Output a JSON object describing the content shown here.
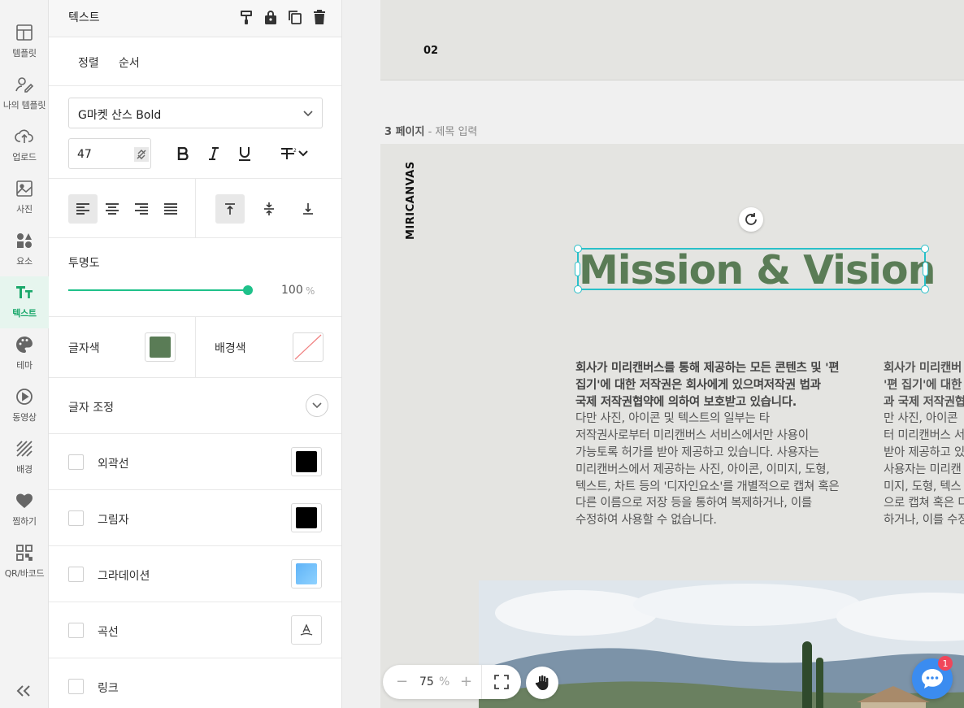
{
  "rail": {
    "items": [
      {
        "label": "템플릿",
        "icon": "template-icon"
      },
      {
        "label": "나의 템플릿",
        "icon": "my-template-icon"
      },
      {
        "label": "업로드",
        "icon": "upload-icon"
      },
      {
        "label": "사진",
        "icon": "photo-icon"
      },
      {
        "label": "요소",
        "icon": "elements-icon"
      },
      {
        "label": "텍스트",
        "icon": "text-icon",
        "active": true
      },
      {
        "label": "테마",
        "icon": "palette-icon"
      },
      {
        "label": "동영상",
        "icon": "video-icon"
      },
      {
        "label": "배경",
        "icon": "background-icon"
      },
      {
        "label": "찜하기",
        "icon": "heart-icon"
      },
      {
        "label": "QR/바코드",
        "icon": "qr-icon"
      }
    ],
    "collapse": "<<"
  },
  "panel": {
    "title": "텍스트",
    "header_icons": [
      "paint-roller-icon",
      "lock-icon",
      "duplicate-icon",
      "trash-icon"
    ],
    "tabs": {
      "align": "정렬",
      "order": "순서"
    },
    "font_family": "G마켓 산스 Bold",
    "font_size": "47",
    "opacity_label": "투명도",
    "opacity_value": "100",
    "opacity_unit": "%",
    "opacity_fraction": 1.0,
    "text_color_label": "글자색",
    "text_color": "#5a7c56",
    "bg_color_label": "배경색",
    "adjust_label": "글자 조정",
    "options": [
      {
        "label": "외곽선",
        "swatch": "#000000"
      },
      {
        "label": "그림자",
        "swatch": "#000000"
      },
      {
        "label": "그라데이션",
        "swatch": "#6fb8f5"
      },
      {
        "label": "곡선",
        "swatch": "curve"
      },
      {
        "label": "링크",
        "swatch": ""
      }
    ]
  },
  "canvas": {
    "prev_page_number": "02",
    "page_label_num": "3 페이지",
    "page_label_rest": " - 제목 입력",
    "brand": "MIRICANVAS",
    "headline": "Mission & Vision",
    "headline_color": "#5a7c56",
    "body_left_bold": "회사가 미리캔버스를 통해 제공하는 모든 콘텐츠 및 '편 집기'에 대한 저작권은 회사에게 있으며저작권 법과 국제 저작권협약에 의하여 보호받고 있습니다.",
    "body_left_regular": "다만 사진, 아이콘 및 텍스트의 일부는 타 저작권사로부터 미리캔버스 서비스에서만 사용이 가능토록 허가를 받아 제공하고 있습니다. 사용자는 미리캔버스에서 제공하는 사진, 아이콘, 이미지, 도형, 텍스트, 차트 등의 '디자인요소'를 개별적으로 캡쳐 혹은 다른 이름으로 저장 등을 통하여 복제하거나, 이를 수정하여 사용할 수 없습니다.",
    "body_right_lines": [
      "회사가 미리캔버",
      "'편 집기'에 대한",
      "과 국제 저작권협",
      "만 사진, 아이콘",
      "터 미리캔버스 서",
      "받아 제공하고 있",
      "사용자는 미리캔",
      "미지, 도형, 텍스",
      "으로 캡쳐 혹은 디",
      "하거나, 이를 수정"
    ]
  },
  "zoom": {
    "minus": "−",
    "value": "75",
    "unit": "%",
    "plus": "+"
  },
  "chat": {
    "badge": "1"
  }
}
